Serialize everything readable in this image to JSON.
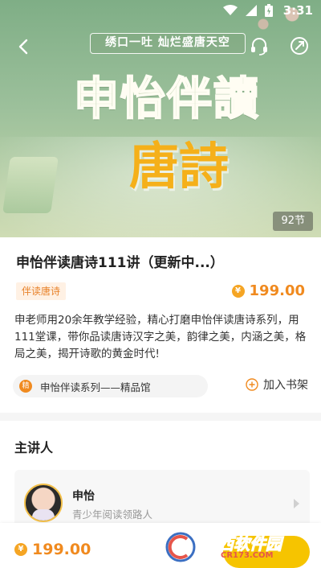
{
  "status_bar": {
    "time": "3:31"
  },
  "banner": {
    "slogan": "绣口一吐 灿烂盛唐天空",
    "title_line1": "申怡伴讀",
    "title_line2": "唐詩",
    "episode_count": "92节"
  },
  "course": {
    "title": "申怡伴读唐诗111讲（更新中...）",
    "tag": "伴读唐诗",
    "price": "199.00",
    "coin_symbol": "¥",
    "description": "申老师用20余年教学经验，精心打磨申怡伴读唐诗系列，用111堂课，带你品读唐诗汉字之美，韵律之美，内涵之美，格局之美，揭开诗歌的黄金时代!",
    "series_badge": "精",
    "series_name": "申怡伴读系列——精品馆",
    "bookshelf_label": "加入书架"
  },
  "lecturer_section": {
    "title": "主讲人",
    "name": "申怡",
    "role": "青少年阅读领路人"
  },
  "bottom_bar": {
    "price": "199.00",
    "coin_symbol": "¥"
  },
  "watermark": {
    "title": "西西软件园",
    "url": "CR173.COM"
  },
  "colors": {
    "accent": "#f08a1f",
    "buy_button": "#f6c400",
    "banner_green": "#9cc09b"
  }
}
